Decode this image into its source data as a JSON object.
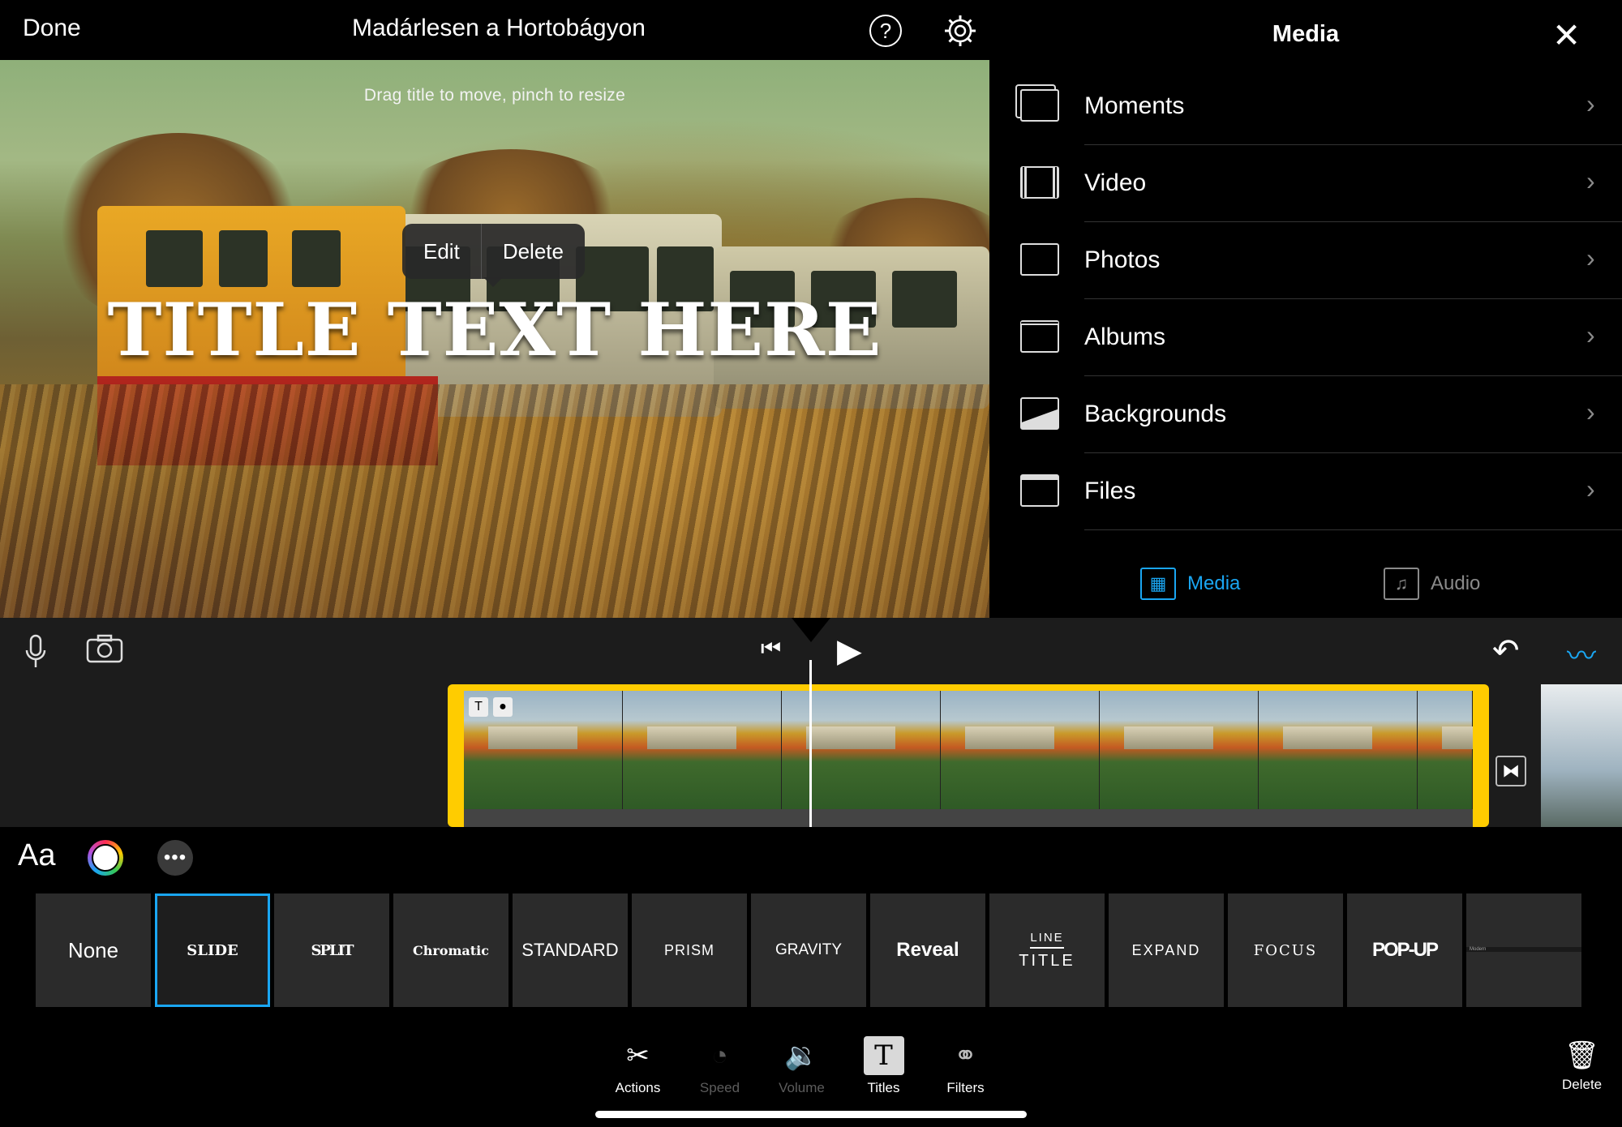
{
  "header": {
    "done_label": "Done",
    "project_title": "Madárlesen a Hortobágyon",
    "help_icon": "question-circle-icon",
    "settings_icon": "gear-icon"
  },
  "preview": {
    "hint": "Drag title to move, pinch to resize",
    "title_text": "TITLE TEXT HERE",
    "edit_label": "Edit",
    "delete_label": "Delete"
  },
  "media_panel": {
    "title": "Media",
    "close_icon": "close-icon",
    "items": [
      {
        "label": "Moments",
        "icon": "moments-icon"
      },
      {
        "label": "Video",
        "icon": "film-icon"
      },
      {
        "label": "Photos",
        "icon": "photo-frame-icon"
      },
      {
        "label": "Albums",
        "icon": "albums-icon"
      },
      {
        "label": "Backgrounds",
        "icon": "backgrounds-icon"
      },
      {
        "label": "Files",
        "icon": "folder-icon"
      }
    ],
    "tabs": [
      {
        "label": "Media",
        "active": true
      },
      {
        "label": "Audio",
        "active": false
      }
    ],
    "accent_color": "#1aa6f2"
  },
  "timeline": {
    "clip_badges": [
      "T",
      "●"
    ],
    "clip_frame_count": 6,
    "clip_border_color": "#ffcc00"
  },
  "title_styles": {
    "items": [
      {
        "label": "None",
        "selected": false
      },
      {
        "label": "SLIDE",
        "selected": true
      },
      {
        "label": "SPLIT",
        "selected": false
      },
      {
        "label": "Chromatic",
        "selected": false
      },
      {
        "label": "STANDARD",
        "selected": false
      },
      {
        "label": "PRISM",
        "selected": false
      },
      {
        "label": "GRAVITY",
        "selected": false
      },
      {
        "label": "Reveal",
        "selected": false
      },
      {
        "label": "LINE",
        "label2": "TITLE",
        "selected": false
      },
      {
        "label": "EXPAND",
        "selected": false
      },
      {
        "label": "FOCUS",
        "selected": false
      },
      {
        "label": "POP-UP",
        "selected": false
      },
      {
        "label": "Modern",
        "selected": false
      }
    ],
    "font_label": "Aa"
  },
  "toolbar": {
    "actions": "Actions",
    "speed": "Speed",
    "volume": "Volume",
    "titles": "Titles",
    "filters": "Filters",
    "delete": "Delete"
  }
}
